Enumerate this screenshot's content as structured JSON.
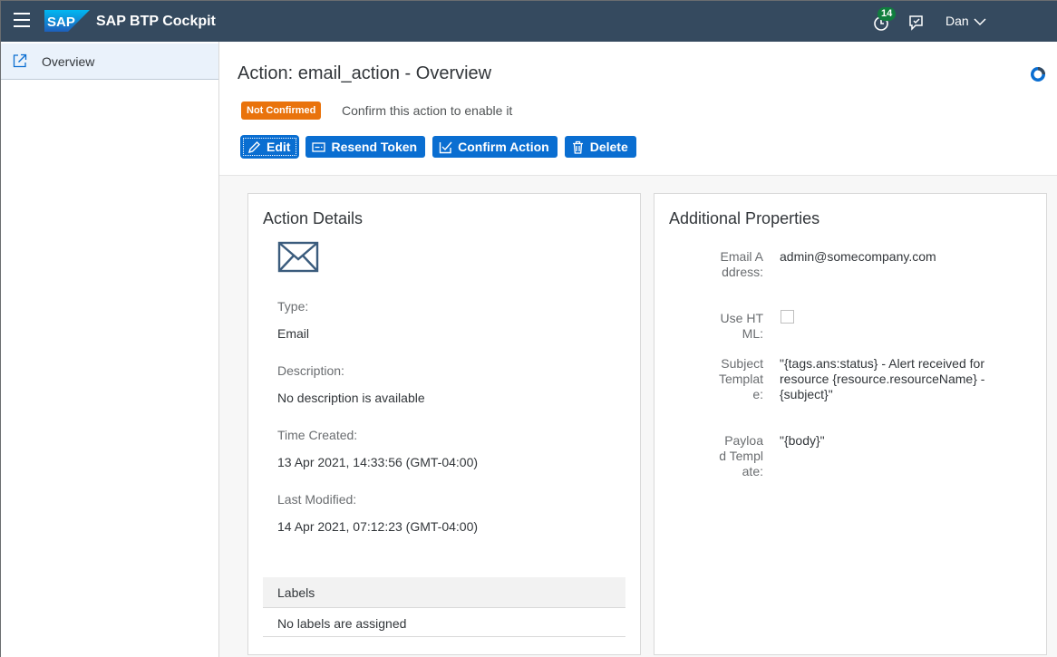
{
  "shell": {
    "app_title": "SAP BTP Cockpit",
    "notification_count": "14",
    "user_name": "Dan",
    "logo_text": "SAP"
  },
  "sidebar": {
    "items": [
      {
        "label": "Overview",
        "icon": "external-link-icon",
        "selected": true
      }
    ]
  },
  "header": {
    "title": "Action: email_action - Overview",
    "status_badge": "Not Confirmed",
    "status_message": "Confirm this action to enable it",
    "buttons": {
      "edit": "Edit",
      "resend": "Resend Token",
      "confirm": "Confirm Action",
      "delete": "Delete"
    }
  },
  "action_details": {
    "title": "Action Details",
    "type_label": "Type:",
    "type_value": "Email",
    "description_label": "Description:",
    "description_value": "No description is available",
    "time_created_label": "Time Created:",
    "time_created_value": "13 Apr 2021, 14:33:56 (GMT-04:00)",
    "last_modified_label": "Last Modified:",
    "last_modified_value": "14 Apr 2021, 07:12:23 (GMT-04:00)",
    "labels_header": "Labels",
    "labels_empty": "No labels are assigned"
  },
  "additional_properties": {
    "title": "Additional Properties",
    "email_label": "Email Address:",
    "email_value": "admin@somecompany.com",
    "use_html_label": "Use HTML:",
    "use_html_checked": false,
    "subject_label": "Subject Template:",
    "subject_value": "\"{tags.ans:status} - Alert received for resource {resource.resourceName} - {subject}\"",
    "payload_label": "Payload Template:",
    "payload_value": "\"{body}\""
  },
  "colors": {
    "shell_bg": "#354a5f",
    "button_blue": "#0a6ed1",
    "badge_orange": "#e9730c",
    "notification_green": "#107e3e"
  }
}
